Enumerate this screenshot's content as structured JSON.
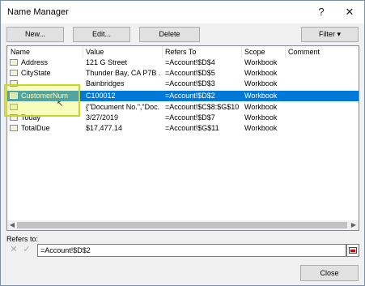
{
  "window": {
    "title": "Name Manager",
    "help": "?",
    "close": "✕"
  },
  "toolbar": {
    "new_label": "New...",
    "edit_label": "Edit...",
    "delete_label": "Delete",
    "filter_label": "Filter ▾"
  },
  "list": {
    "columns": [
      "Name",
      "Value",
      "Refers To",
      "Scope",
      "Comment"
    ],
    "rows": [
      {
        "name": "Address",
        "value": "121 G Street",
        "refers": "=Account!$D$4",
        "scope": "Workbook"
      },
      {
        "name": "CityState",
        "value": "Thunder Bay, CA P7B ...",
        "refers": "=Account!$D$5",
        "scope": "Workbook"
      },
      {
        "name": "",
        "value": "Bainbridges",
        "refers": "=Account!$D$3",
        "scope": "Workbook"
      },
      {
        "name": "CustomerNum",
        "value": "C100012",
        "refers": "=Account!$D$2",
        "scope": "Workbook"
      },
      {
        "name": "",
        "value": "{\"Document No.\",\"Doc...",
        "refers": "=Account!$C$8:$G$10",
        "scope": "Workbook"
      },
      {
        "name": "Today",
        "value": "3/27/2019",
        "refers": "=Account!$D$7",
        "scope": "Workbook"
      },
      {
        "name": "TotalDue",
        "value": "$17,477.14",
        "refers": "=Account!$G$11",
        "scope": "Workbook"
      }
    ],
    "selected_index": 3
  },
  "refers_to": {
    "label": "Refers to:",
    "value": "=Account!$D$2"
  },
  "footer": {
    "close_label": "Close"
  },
  "colors": {
    "selection": "#0078d7",
    "highlight": "#c5d62a"
  },
  "icons": [
    "range-name-icon",
    "cancel-x-icon",
    "confirm-check-icon",
    "collapse-dialog-icon"
  ]
}
